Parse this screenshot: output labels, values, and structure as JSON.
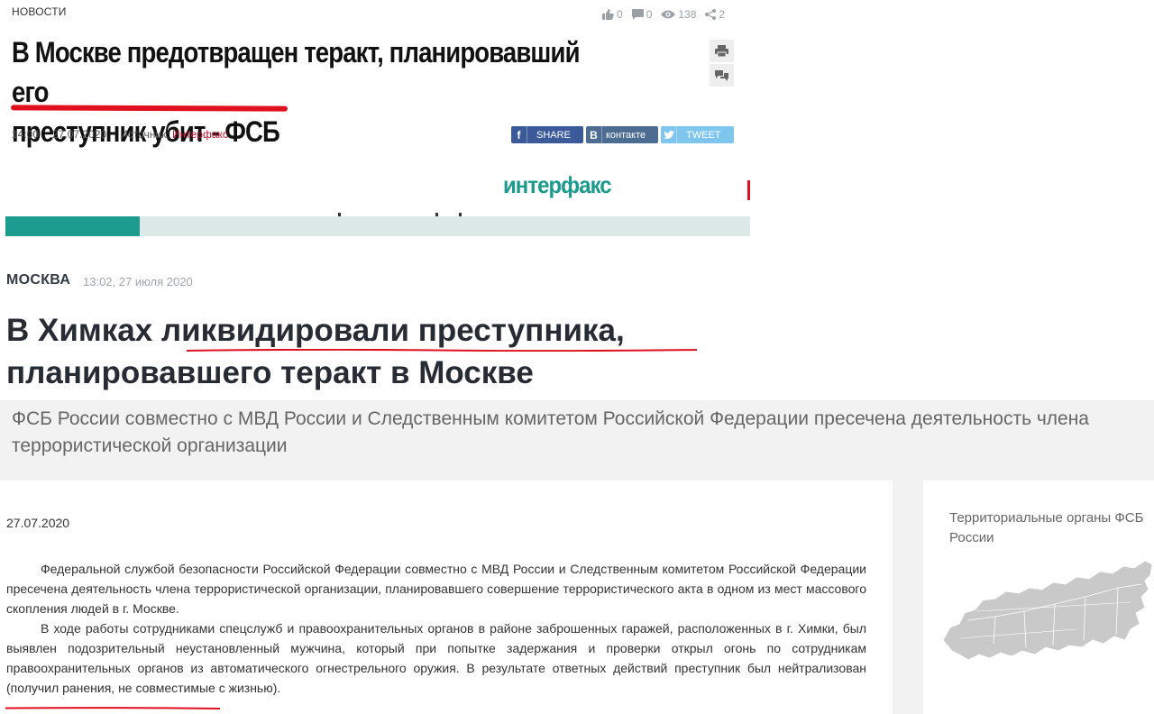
{
  "news_card": {
    "rubric": "НОВОСТИ",
    "stats": {
      "likes": "0",
      "comments": "0",
      "views": "138",
      "shares": "2"
    },
    "headline_line1": "В Москве предотвращен теракт, планировавший его",
    "headline_line2": "преступник убит - ФСБ",
    "time": "14:00",
    "date": "27.07.2020",
    "source_label": "Источник:",
    "source_name": "Интерфакс",
    "share_buttons": {
      "facebook": "SHARE",
      "vkontakte": "контакте",
      "twitter": "TWEET"
    },
    "share_icons": {
      "facebook": "f",
      "vkontakte": "В"
    },
    "logo": "интерфакс",
    "progress": 0.18,
    "colors": {
      "brand": "#1c9b8f",
      "red_mark": "#e0101e"
    }
  },
  "fsb_article": {
    "city": "МОСКВА",
    "datetime": "13:02, 27 июля 2020",
    "headline_line1": "В Химках ликвидировали преступника,",
    "headline_line2": "планировавшего теракт в Москве",
    "lead": "ФСБ России совместно с МВД России и Следственным комитетом Российской Федерации пресечена деятельность члена террористической организации",
    "date": "27.07.2020",
    "paragraph1": "Федеральной службой безопасности Российской Федерации совместно с МВД России и Следственным комитетом Российской Федерации пресечена  деятельность члена террористической организации, планировавшего совершение террористического акта в одном из мест массового скопления людей в г. Москве.",
    "paragraph2": "В ходе работы сотрудниками спецслужб и правоохранительных органов в районе заброшенных гаражей, расположенных в г. Химки, был выявлен подозрительный неустановленный мужчина, который при попытке задержания и проверки открыл огонь по сотрудникам правоохранительных органов из автоматического огнестрельного оружия. В результате ответных действий преступник был нейтрализован (получил ранения, не совместимые с жизнью).",
    "sidebar_title": "Территориальные органы ФСБ России"
  }
}
